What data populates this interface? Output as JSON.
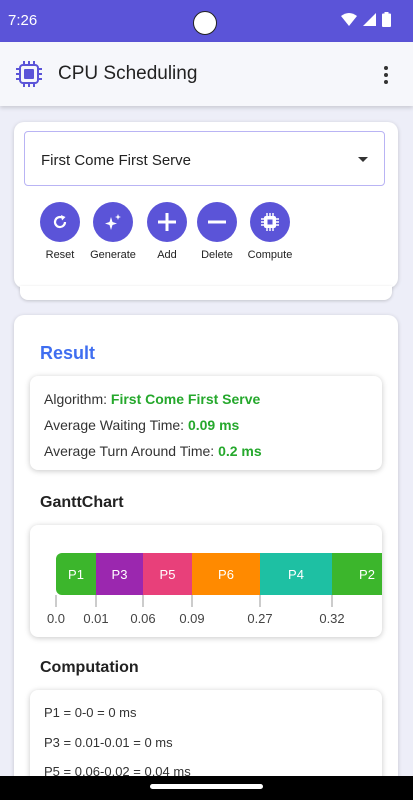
{
  "status_bar": {
    "time": "7:26"
  },
  "app_bar": {
    "title": "CPU Scheduling",
    "logo_icon": "chip-icon",
    "menu_icon": "more-vert-icon"
  },
  "algorithm_select": {
    "value": "First Come First Serve"
  },
  "toolbar": {
    "reset_label": "Reset",
    "generate_label": "Generate",
    "add_label": "Add",
    "delete_label": "Delete",
    "compute_label": "Compute"
  },
  "result": {
    "heading": "Result",
    "algorithm_label": "Algorithm: ",
    "algorithm_value": "First Come First Serve",
    "avg_waiting_label": "Average Waiting Time: ",
    "avg_waiting_value": "0.09 ms",
    "avg_turnaround_label": "Average Turn Around Time: ",
    "avg_turnaround_value": "0.2 ms"
  },
  "gantt": {
    "heading": "GanttChart",
    "blocks": [
      {
        "name": "P1",
        "color": "#3cb62c"
      },
      {
        "name": "P3",
        "color": "#9b27af"
      },
      {
        "name": "P5",
        "color": "#e8407a"
      },
      {
        "name": "P6",
        "color": "#ff8a00"
      },
      {
        "name": "P4",
        "color": "#1ec0a3"
      },
      {
        "name": "P2",
        "color": "#3cb62c"
      }
    ],
    "ticks": [
      "0.0",
      "0.01",
      "0.06",
      "0.09",
      "0.27",
      "0.32"
    ]
  },
  "computation": {
    "heading": "Computation",
    "lines": [
      "P1 = 0-0 = 0 ms",
      "P3 = 0.01-0.01 = 0 ms",
      "P5 = 0.06-0.02 = 0.04 ms"
    ]
  },
  "colors": {
    "primary": "#5b54d8",
    "result_heading": "#3f6ef0",
    "value_green": "#25a82c"
  }
}
